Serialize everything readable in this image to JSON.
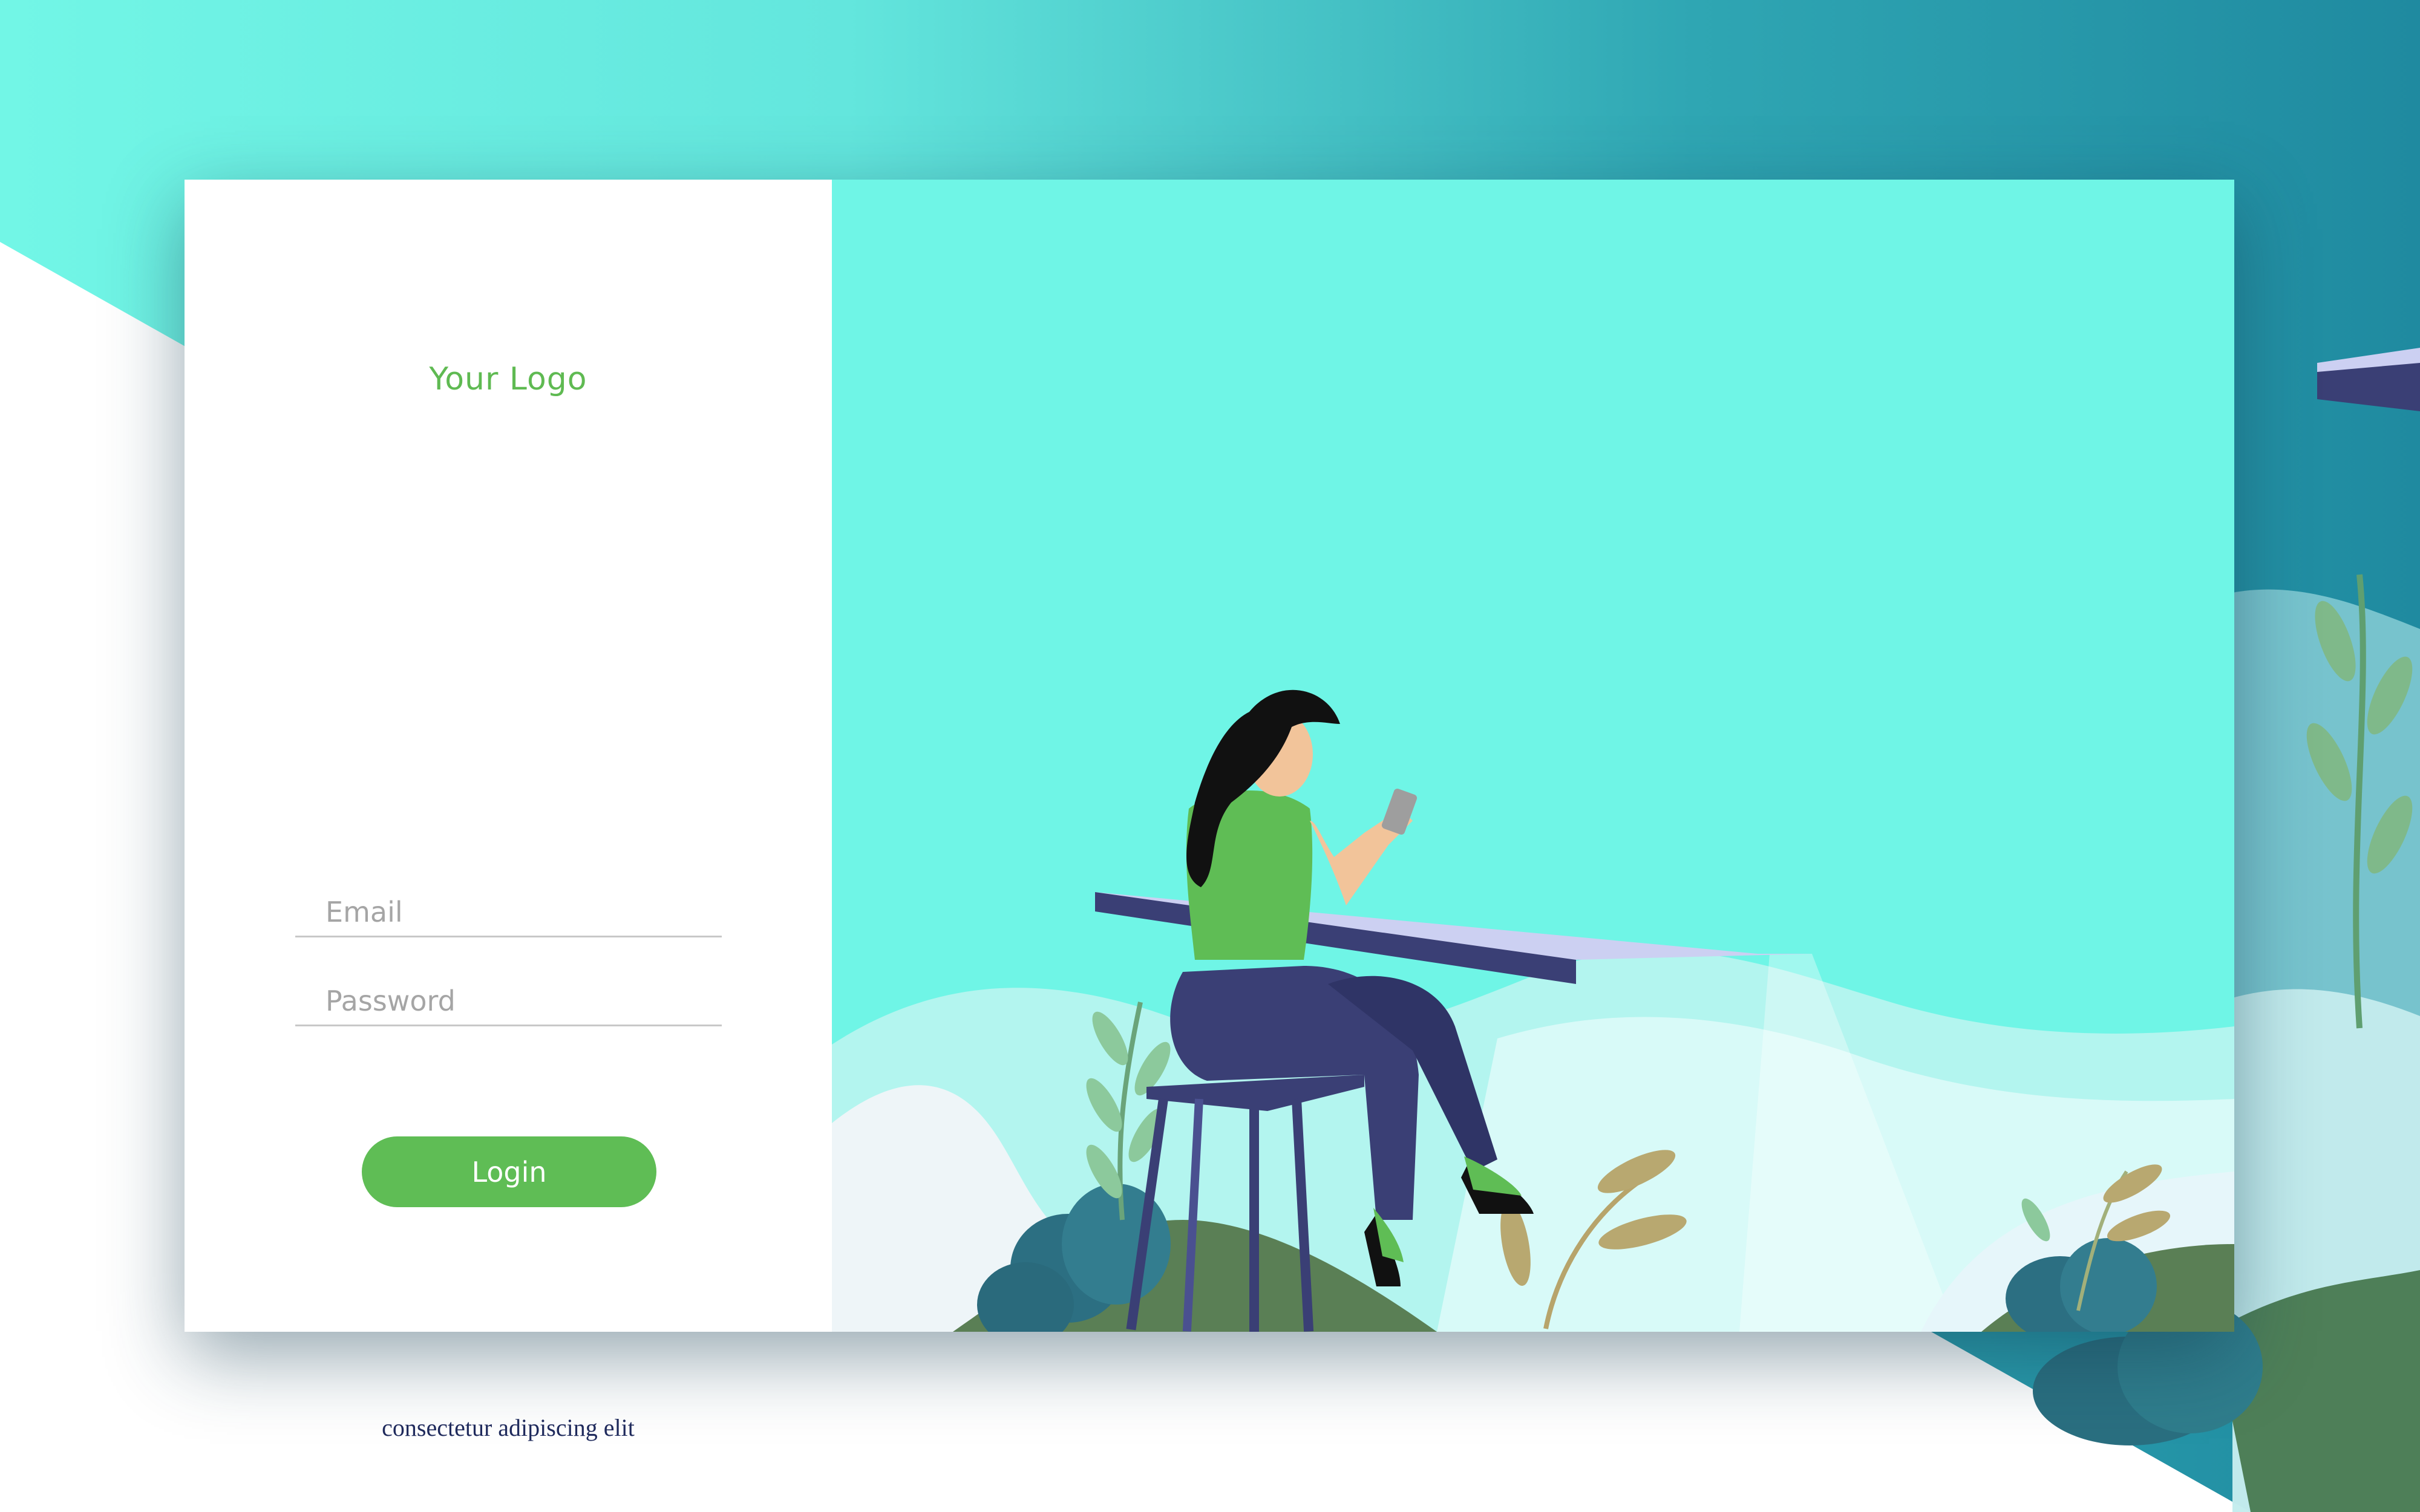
{
  "brand": {
    "logo_text": "Your Logo"
  },
  "login_form": {
    "email_placeholder": "Email",
    "email_value": "",
    "password_placeholder": "Password",
    "password_value": "",
    "login_label": "Login"
  },
  "footer": {
    "tagline": "consectetur adipiscing elit"
  },
  "colors": {
    "accent_green": "#5fbd55",
    "logo_green": "#5fba52",
    "background_teal": "#6ff5e6",
    "deep_teal": "#1f8aa0",
    "navy": "#3a3f75"
  },
  "illustration": {
    "subject": "woman-on-stool-with-phone"
  }
}
